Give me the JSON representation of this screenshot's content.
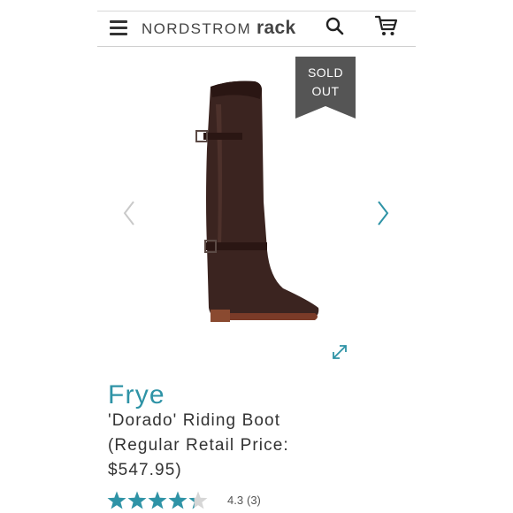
{
  "header": {
    "brand": "NORDSTROM",
    "sub_brand": "rack",
    "menu_icon": "hamburger-menu-icon",
    "search_icon": "search-icon",
    "cart_icon": "shopping-cart-icon"
  },
  "product": {
    "badge_line1": "SOLD",
    "badge_line2": "OUT",
    "brand": "Frye",
    "title_line1": "'Dorado' Riding Boot",
    "title_line2": "(Regular Retail Price:",
    "title_line3": "$547.95)",
    "rating": "4.3",
    "rating_stars_out_of_5": 4.3,
    "review_count": "(3)"
  },
  "colors": {
    "accent": "#2e93a6",
    "badge": "#555555",
    "star_empty": "#d6d6d6"
  },
  "icons": {
    "prev": "chevron-left-icon",
    "next": "chevron-right-icon",
    "expand": "expand-arrows-icon"
  }
}
